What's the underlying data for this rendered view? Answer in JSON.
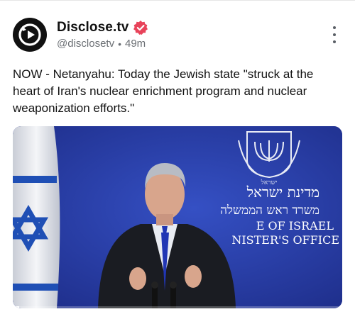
{
  "post": {
    "author_name": "Disclose.tv",
    "handle": "@disclosetv",
    "separator": "•",
    "time_ago": "49m",
    "text": "NOW - Netanyahu: Today the Jewish state \"struck at the heart of Iran's nuclear enrichment program and nuclear weaponization efforts.\""
  },
  "media": {
    "backdrop_hebrew_line1": "מדינת ישראל",
    "backdrop_hebrew_line2": "משרד ראש הממשלה",
    "backdrop_emblem_label": "ישראל",
    "backdrop_english_line1": "E OF ISRAEL",
    "backdrop_english_line2": "NISTER'S OFFICE",
    "video_progress": 0.02
  },
  "colors": {
    "verified_badge": "#e8435a",
    "backdrop_blue": "#2b3fa8",
    "flag_blue": "#1f4fb5"
  },
  "icons": {
    "avatar": "play-logo-icon",
    "verified": "verified-badge-icon",
    "more": "more-options-icon"
  }
}
